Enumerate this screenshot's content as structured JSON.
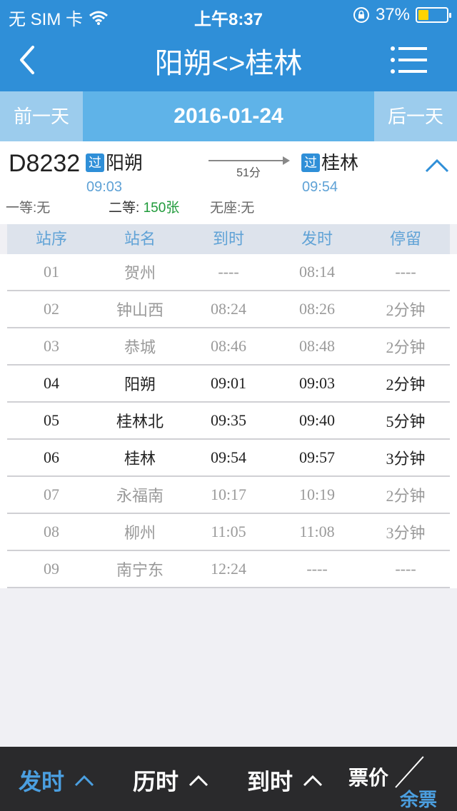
{
  "status_bar": {
    "carrier": "无 SIM 卡",
    "time": "上午8:37",
    "battery": "37%",
    "battery_level": 0.37
  },
  "nav": {
    "title": "阳朔<>桂林",
    "back_icon": "back-chevron-icon",
    "menu_icon": "menu-list-icon"
  },
  "date_bar": {
    "prev_label": "前一天",
    "date": "2016-01-24",
    "next_label": "后一天"
  },
  "train": {
    "number": "D8232",
    "from_badge": "过",
    "from_station": "阳朔",
    "from_time": "09:03",
    "duration": "51分",
    "to_badge": "过",
    "to_station": "桂林",
    "to_time": "09:54",
    "seats": {
      "first_class_label": "一等:",
      "first_class_value": "无",
      "second_class_label": "二等:",
      "second_class_value": "150张",
      "no_seat_label": "无座:",
      "no_seat_value": "无"
    }
  },
  "table": {
    "headers": [
      "站序",
      "站名",
      "到时",
      "发时",
      "停留"
    ],
    "rows": [
      {
        "seq": "01",
        "name": "贺州",
        "arrive": "----",
        "depart": "08:14",
        "stay": "----",
        "active": false
      },
      {
        "seq": "02",
        "name": "钟山西",
        "arrive": "08:24",
        "depart": "08:26",
        "stay": "2分钟",
        "active": false
      },
      {
        "seq": "03",
        "name": "恭城",
        "arrive": "08:46",
        "depart": "08:48",
        "stay": "2分钟",
        "active": false
      },
      {
        "seq": "04",
        "name": "阳朔",
        "arrive": "09:01",
        "depart": "09:03",
        "stay": "2分钟",
        "active": true
      },
      {
        "seq": "05",
        "name": "桂林北",
        "arrive": "09:35",
        "depart": "09:40",
        "stay": "5分钟",
        "active": true
      },
      {
        "seq": "06",
        "name": "桂林",
        "arrive": "09:54",
        "depart": "09:57",
        "stay": "3分钟",
        "active": true
      },
      {
        "seq": "07",
        "name": "永福南",
        "arrive": "10:17",
        "depart": "10:19",
        "stay": "2分钟",
        "active": false
      },
      {
        "seq": "08",
        "name": "柳州",
        "arrive": "11:05",
        "depart": "11:08",
        "stay": "3分钟",
        "active": false
      },
      {
        "seq": "09",
        "name": "南宁东",
        "arrive": "12:24",
        "depart": "----",
        "stay": "----",
        "active": false
      }
    ]
  },
  "bottom_bar": {
    "depart_sort": "发时",
    "duration_sort": "历时",
    "arrive_sort": "到时",
    "price_label": "票价",
    "remaining_label": "余票"
  },
  "colors": {
    "primary": "#2f8fd8",
    "date_bar": "#5fb3e8",
    "seat_available": "#1f9a3a",
    "time_blue": "#5fa2d6"
  }
}
